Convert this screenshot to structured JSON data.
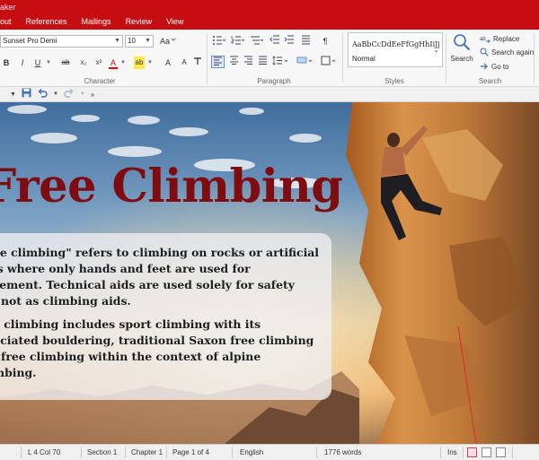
{
  "app": {
    "title": "aker"
  },
  "menubar": {
    "items": [
      "out",
      "References",
      "Mailings",
      "Review",
      "View"
    ]
  },
  "ribbon": {
    "font_name": "Sunset Pro Demi",
    "font_size": "10",
    "styles_sample": "AaBbCcDdEeFfGgHhIiJj",
    "style_name": "Normal",
    "groups": {
      "character": "Character",
      "paragraph": "Paragraph",
      "styles": "Styles",
      "search": "Search"
    },
    "search": {
      "big_label": "Search",
      "replace": "Replace",
      "search_again": "Search again",
      "go_to": "Go to"
    },
    "format_buttons": {
      "bold": "B",
      "italic": "I",
      "underline": "U",
      "strike": "ab",
      "subscript": "x₂",
      "superscript": "x²",
      "font_color": "A",
      "highlight": "ab",
      "grow": "A",
      "shrink": "A"
    }
  },
  "document": {
    "title": "Free Climbing",
    "paragraphs": [
      [
        "ee climbing\" refers to climbing on rocks or artificial",
        "ls where only hands and feet are used for",
        "vement. Technical aids are used solely for safety",
        "l not as climbing aids."
      ],
      [
        "e climbing includes sport climbing with its",
        "ociated bouldering, traditional Saxon free climbing",
        "l free climbing within the context of alpine",
        "mbing."
      ]
    ]
  },
  "statusbar": {
    "position": "L 4 Col 70",
    "section": "Section 1",
    "chapter": "Chapter 1",
    "page": "Page 1 of 4",
    "language": "English",
    "words": "1776 words",
    "mode": "Ins"
  },
  "colors": {
    "accent": "#c50d12",
    "title": "#7f0c10"
  }
}
